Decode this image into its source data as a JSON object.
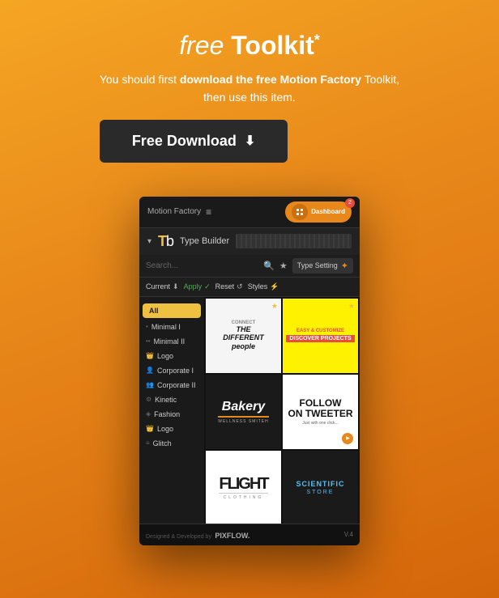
{
  "header": {
    "title_free": "free",
    "title_toolkit": "Toolkit",
    "asterisk": "*",
    "subtitle_line1": "You should first ",
    "subtitle_bold1": "download the free",
    "subtitle_bold2": "Motion Factory",
    "subtitle_plain1": "Toolkit,",
    "subtitle_line2": "then use this item.",
    "download_btn_label": "Free Download",
    "download_icon": "⬇"
  },
  "app": {
    "topbar": {
      "app_name": "Motion Factory",
      "menu_icon": "≡",
      "notification_count": "2",
      "dashboard_label": "Dashboard"
    },
    "type_builder": {
      "chevron": "▾",
      "logo_tb": "Tb",
      "label": "Type Builder"
    },
    "search": {
      "placeholder": "Search...",
      "type_setting": "Type Setting"
    },
    "toolbar": {
      "current_label": "Current",
      "apply_label": "Apply",
      "reset_label": "Reset",
      "styles_label": "Styles"
    },
    "sidebar": {
      "items": [
        {
          "label": "All",
          "active": true
        },
        {
          "label": "Minimal I"
        },
        {
          "label": "Minimal II"
        },
        {
          "label": "Logo"
        },
        {
          "label": "Corporate I"
        },
        {
          "label": "Corporate II"
        },
        {
          "label": "Kinetic"
        },
        {
          "label": "Fashion"
        },
        {
          "label": "Logo"
        },
        {
          "label": "Glitch"
        }
      ]
    },
    "grid": {
      "items": [
        {
          "type": "light",
          "text1": "CONNECT",
          "text2": "THE\nDIFFERENT\npeople"
        },
        {
          "type": "yellow",
          "text1": "EASY & CUSTOMIZE",
          "text2": "DISCOVER PROJECTS"
        },
        {
          "type": "dark",
          "text": "Bakery"
        },
        {
          "type": "white",
          "text1": "FOLLOW",
          "text2": "ON TWEETER",
          "sub": "Just with one click..."
        },
        {
          "type": "flight",
          "text1": "FLIGHT",
          "text2": "CLOTHING"
        },
        {
          "type": "scientific",
          "text1": "SCIENTIFIC",
          "text2": "STORE"
        }
      ]
    },
    "bottom": {
      "designed_label": "Designed & Developed by",
      "brand": "PIXFLOW.",
      "version": "V.4"
    }
  }
}
